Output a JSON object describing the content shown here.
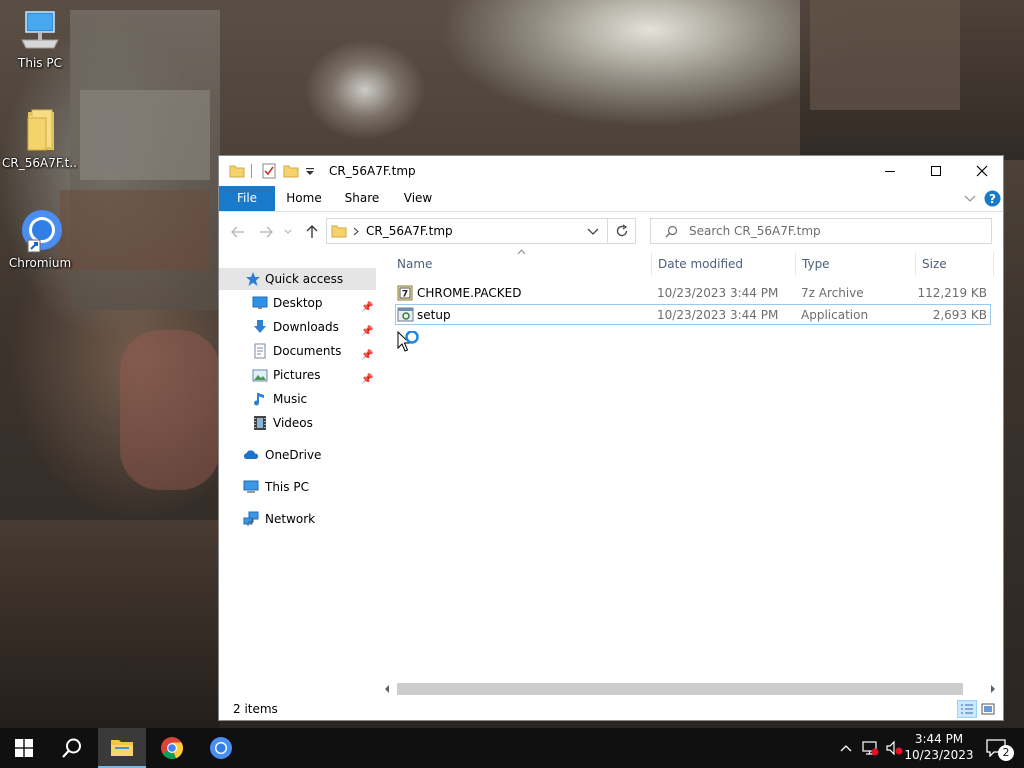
{
  "desktop": {
    "icons": [
      {
        "label": "This PC"
      },
      {
        "label": "CR_56A7F.t..."
      },
      {
        "label": "Chromium"
      }
    ]
  },
  "window": {
    "title": "CR_56A7F.tmp",
    "ribbon_tabs": [
      "File",
      "Home",
      "Share",
      "View"
    ],
    "address": "CR_56A7F.tmp",
    "search_placeholder": "Search CR_56A7F.tmp"
  },
  "nav": {
    "items": [
      {
        "label": "Quick access",
        "icon": "star-icon"
      },
      {
        "label": "Desktop",
        "icon": "desktop-icon",
        "pinned": true
      },
      {
        "label": "Downloads",
        "icon": "download-arrow-icon",
        "pinned": true
      },
      {
        "label": "Documents",
        "icon": "documents-icon",
        "pinned": true
      },
      {
        "label": "Pictures",
        "icon": "pictures-icon",
        "pinned": true
      },
      {
        "label": "Music",
        "icon": "music-note-icon"
      },
      {
        "label": "Videos",
        "icon": "film-icon"
      },
      {
        "label": "OneDrive",
        "icon": "cloud-icon"
      },
      {
        "label": "This PC",
        "icon": "computer-icon"
      },
      {
        "label": "Network",
        "icon": "network-icon"
      }
    ]
  },
  "list": {
    "columns": [
      "Name",
      "Date modified",
      "Type",
      "Size"
    ],
    "rows": [
      {
        "name": "CHROME.PACKED",
        "date": "10/23/2023 3:44 PM",
        "type": "7z Archive",
        "size": "112,219 KB",
        "icon": "archive-icon"
      },
      {
        "name": "setup",
        "date": "10/23/2023 3:44 PM",
        "type": "Application",
        "size": "2,693 KB",
        "icon": "application-icon"
      }
    ]
  },
  "status": {
    "text": "2 items"
  },
  "taskbar": {
    "time": "3:44 PM",
    "date": "10/23/2023",
    "notification_count": "2"
  },
  "colors": {
    "file_tab": "#1979ca",
    "header_text": "#4c607a",
    "focus_border": "#99c9ef",
    "taskbar": "#101010",
    "folder": "#f4d36a"
  }
}
